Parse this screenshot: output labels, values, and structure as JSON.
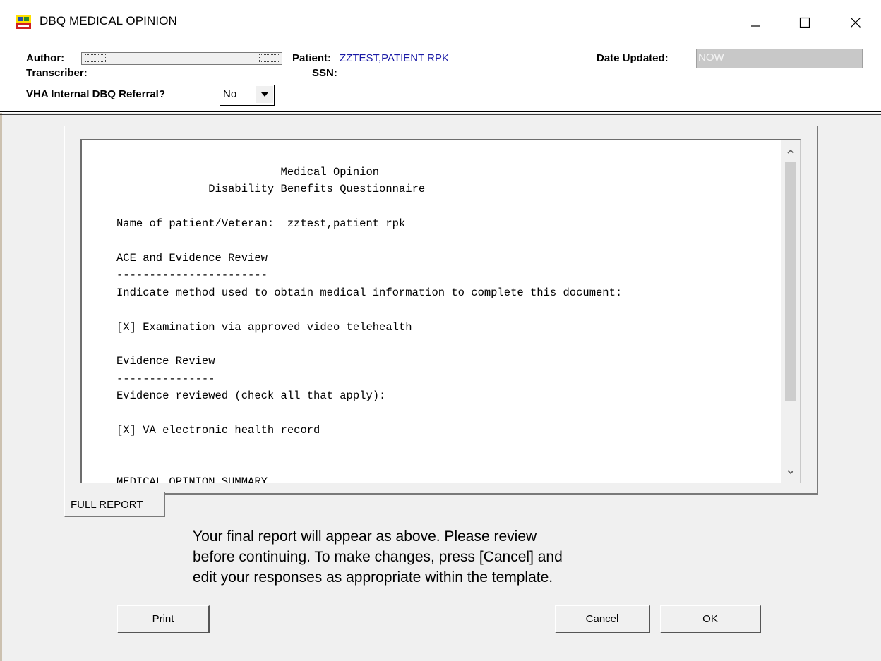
{
  "window": {
    "title": "DBQ MEDICAL OPINION",
    "icon": "app-icon"
  },
  "header": {
    "author_label": "Author:",
    "author_value": "",
    "patient_label": "Patient:",
    "patient_name": "ZZTEST,PATIENT RPK",
    "transcriber_label": "Transcriber:",
    "ssn_label": "SSN:",
    "date_updated_label": "Date Updated:",
    "date_updated_value": "NOW",
    "referral_label": "VHA Internal DBQ Referral?",
    "referral_value": "No"
  },
  "report": {
    "lines": [
      "                         Medical Opinion",
      "              Disability Benefits Questionnaire",
      "",
      "Name of patient/Veteran:  zztest,patient rpk",
      "",
      "ACE and Evidence Review",
      "-----------------------",
      "Indicate method used to obtain medical information to complete this document:",
      "",
      "[X] Examination via approved video telehealth",
      "",
      "Evidence Review",
      "---------------",
      "Evidence reviewed (check all that apply):",
      "",
      "[X] VA electronic health record",
      "",
      "",
      "MEDICAL OPINION SUMMARY"
    ]
  },
  "tab": {
    "label": "FULL REPORT"
  },
  "notice": {
    "line1": "Your final report will appear as above.  Please review",
    "line2": "before continuing.  To make changes, press [Cancel] and",
    "line3": "edit your responses as appropriate within the template."
  },
  "buttons": {
    "print": "Print",
    "cancel": "Cancel",
    "ok": "OK"
  },
  "colors": {
    "patient_name": "#1a1aa6",
    "date_box": "#c8c8c8",
    "background": "#f0f0f0"
  }
}
